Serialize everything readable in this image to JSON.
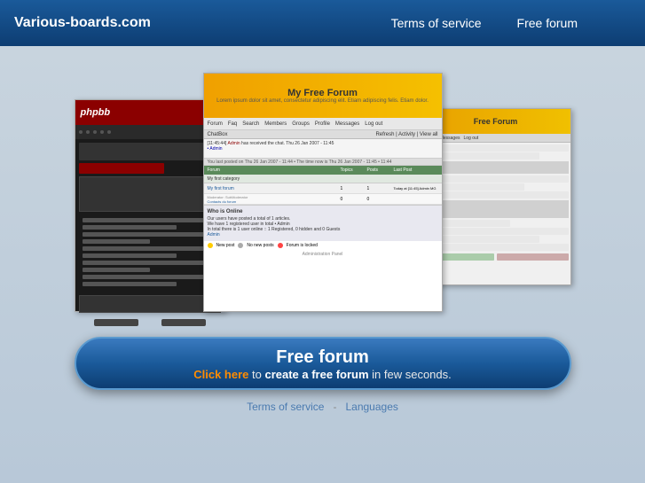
{
  "header": {
    "logo": "Various-boards.com",
    "nav": {
      "terms": "Terms of service",
      "free_forum": "Free forum"
    }
  },
  "screenshots": {
    "left": {
      "logo": "phpbb",
      "alt": "Dark phpbb theme screenshot"
    },
    "center": {
      "title": "My Free Forum",
      "desc": "Lorem ipsum dolor sit amet, consectetur adipiscing elit. Etiam adipiscing felis. Etiam dolor.",
      "nav_items": [
        "Forum",
        "Faq",
        "Search",
        "Members",
        "Groups",
        "Profile",
        "Messages",
        "Log out"
      ],
      "chat_label": "ChatBox",
      "table_header": [
        "Forum",
        "Topics",
        "Posts",
        "Last Post"
      ],
      "category": "My first category",
      "forums": [
        "My first forum",
        "No Subforum",
        "Subforum",
        "Subforum",
        "Contacts du forum"
      ],
      "info_title": "Who is Online"
    },
    "right": {
      "title": "Free Forum",
      "alt": "Right forum screenshot"
    }
  },
  "cta": {
    "title": "Free forum",
    "sub_prefix": "Click here",
    "sub_middle": " to ",
    "sub_bold": "create a free forum",
    "sub_suffix": " in few seconds."
  },
  "footer": {
    "terms": "Terms of service",
    "separator": "-",
    "languages": "Languages"
  }
}
